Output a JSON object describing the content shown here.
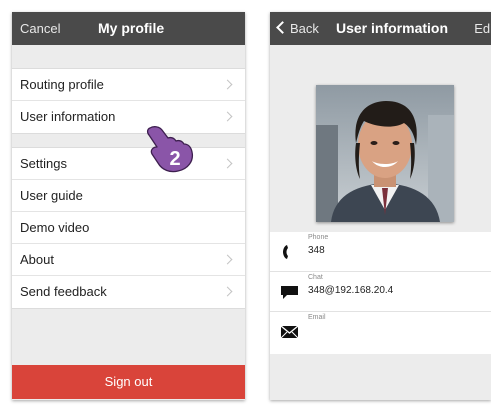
{
  "left_screen": {
    "navbar": {
      "cancel_label": "Cancel",
      "title": "My profile"
    },
    "menu_group_1": [
      {
        "label": "Routing profile"
      },
      {
        "label": "User information"
      }
    ],
    "menu_group_2": [
      {
        "label": "Settings"
      },
      {
        "label": "User guide"
      },
      {
        "label": "Demo video"
      },
      {
        "label": "About"
      },
      {
        "label": "Send feedback"
      }
    ],
    "sign_out_label": "Sign out",
    "step_badge": "2"
  },
  "right_screen": {
    "navbar": {
      "back_label": "Back",
      "title": "User information",
      "edit_label": "Edi"
    },
    "info": [
      {
        "icon": "phone-icon",
        "label": "Phone",
        "value": "348"
      },
      {
        "icon": "chat-icon",
        "label": "Chat",
        "value": "348@192.168.20.4"
      },
      {
        "icon": "email-icon",
        "label": "Email",
        "value": ""
      }
    ]
  },
  "colors": {
    "navbar": "#4a4a4a",
    "sign_out": "#d9443a",
    "hand_fill": "#8a55a8",
    "background": "#ececec"
  }
}
